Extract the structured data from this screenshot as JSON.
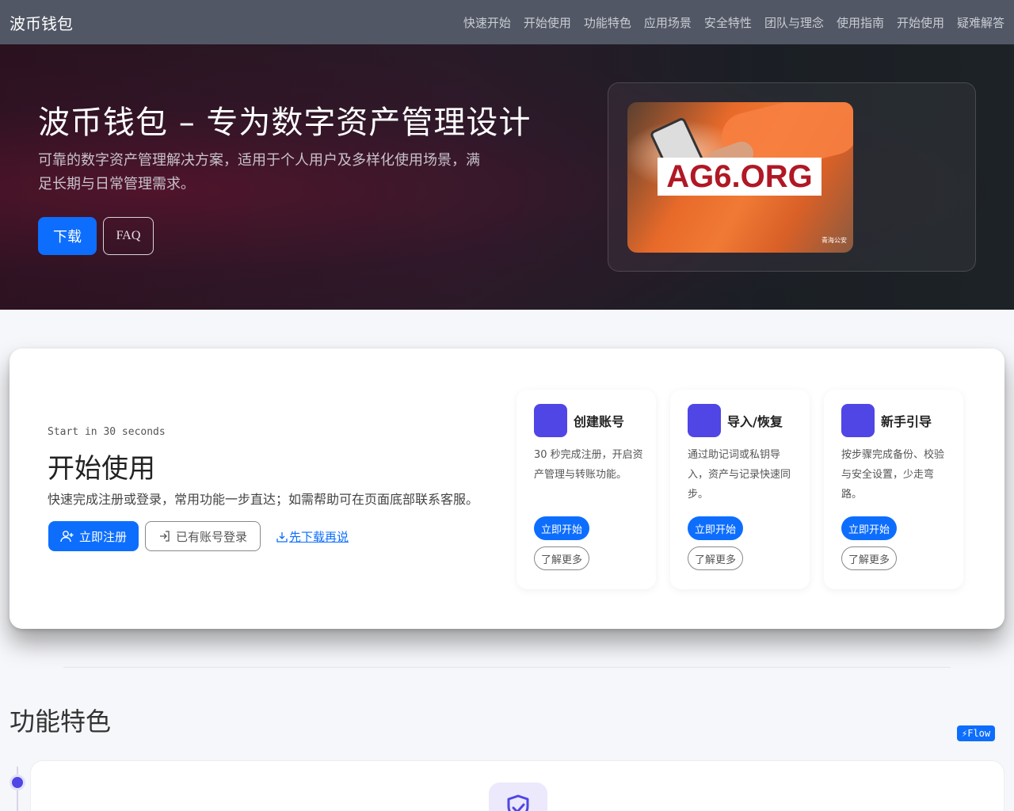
{
  "navbar": {
    "brand": "波币钱包",
    "items": [
      "快速开始",
      "开始使用",
      "功能特色",
      "应用场景",
      "安全特性",
      "团队与理念",
      "使用指南",
      "开始使用",
      "疑难解答"
    ]
  },
  "hero": {
    "title": "波币钱包 – 专为数字资产管理设计",
    "subtitle": "可靠的数字资产管理解决方案，适用于个人用户及多样化使用场景，满足长期与日常管理需求。",
    "download_label": "下载",
    "faq_label": "FAQ",
    "image": {
      "watermark": "AG6.ORG",
      "source_tag": "青海公安"
    }
  },
  "start": {
    "eyebrow": "Start in 30 seconds",
    "title": "开始使用",
    "description": "快速完成注册或登录，常用功能一步直达；如需帮助可在页面底部联系客服。",
    "register_label": "立即注册",
    "login_label": "已有账号登录",
    "download_link": "先下载再说",
    "steps": [
      {
        "title": "创建账号",
        "desc": "30 秒完成注册，开启资产管理与转账功能。",
        "go": "立即开始",
        "more": "了解更多"
      },
      {
        "title": "导入/恢复",
        "desc": "通过助记词或私钥导入，资产与记录快速同步。",
        "go": "立即开始",
        "more": "了解更多"
      },
      {
        "title": "新手引导",
        "desc": "按步骤完成备份、校验与安全设置，少走弯路。",
        "go": "立即开始",
        "more": "了解更多"
      }
    ]
  },
  "features": {
    "title": "功能特色",
    "badge": "⚡Flow"
  },
  "colors": {
    "navbar_bg": "#525765",
    "primary": "#0d6efd",
    "step_icon": "#4f46e5"
  }
}
